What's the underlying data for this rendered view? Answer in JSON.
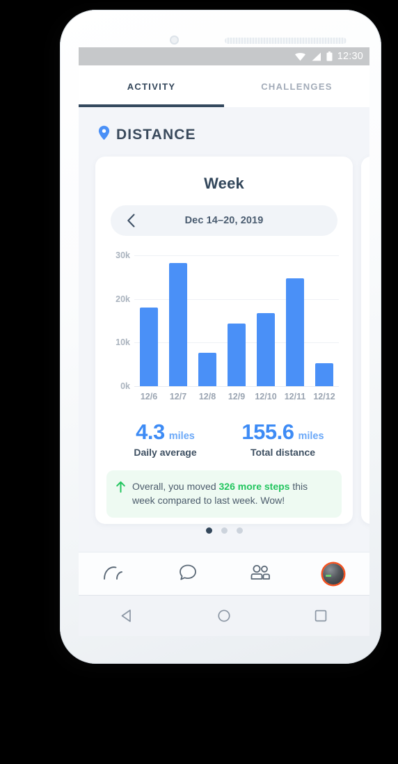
{
  "status_bar": {
    "time": "12:30",
    "icons": [
      "wifi-icon",
      "signal-icon",
      "battery-icon"
    ]
  },
  "tabs": [
    {
      "label": "ACTIVITY",
      "active": true
    },
    {
      "label": "CHALLENGES",
      "active": false
    }
  ],
  "section": {
    "icon": "location-pin-icon",
    "title": "DISTANCE",
    "accent_color": "#4a90f7"
  },
  "card": {
    "title": "Week",
    "date_range": "Dec 14–20, 2019",
    "prev_icon": "chevron-left-icon"
  },
  "stats": [
    {
      "value": "4.3",
      "unit": "miles",
      "label": "Daily average"
    },
    {
      "value": "155.6",
      "unit": "miles",
      "label": "Total distance"
    }
  ],
  "insight": {
    "icon": "arrow-up-icon",
    "text_before": "Overall, you moved ",
    "highlight": "326 more steps",
    "text_after": " this week compared to last week. Wow!",
    "highlight_color": "#22c55e",
    "background_color": "#eefaf2"
  },
  "pager": {
    "total": 3,
    "active_index": 0
  },
  "bottom_nav": [
    {
      "name": "dashboard-icon",
      "label": "Dashboard"
    },
    {
      "name": "chat-icon",
      "label": "Chat"
    },
    {
      "name": "friends-icon",
      "label": "Friends"
    },
    {
      "name": "profile-avatar",
      "label": "Profile"
    }
  ],
  "android_nav": [
    {
      "name": "back-button"
    },
    {
      "name": "home-button"
    },
    {
      "name": "recents-button"
    }
  ],
  "chart_data": {
    "type": "bar",
    "title": "Week",
    "categories": [
      "12/6",
      "12/7",
      "12/8",
      "12/9",
      "12/10",
      "12/11",
      "12/12"
    ],
    "values": [
      18000,
      28300,
      7700,
      14300,
      16800,
      24700,
      5200
    ],
    "ylabel": "",
    "xlabel": "",
    "ylim": [
      0,
      30000
    ],
    "yticks": [
      0,
      10000,
      20000,
      30000
    ],
    "ytick_labels": [
      "0k",
      "10k",
      "20k",
      "30k"
    ],
    "grid": true,
    "legend": false,
    "bar_color": "#4a90f7"
  }
}
